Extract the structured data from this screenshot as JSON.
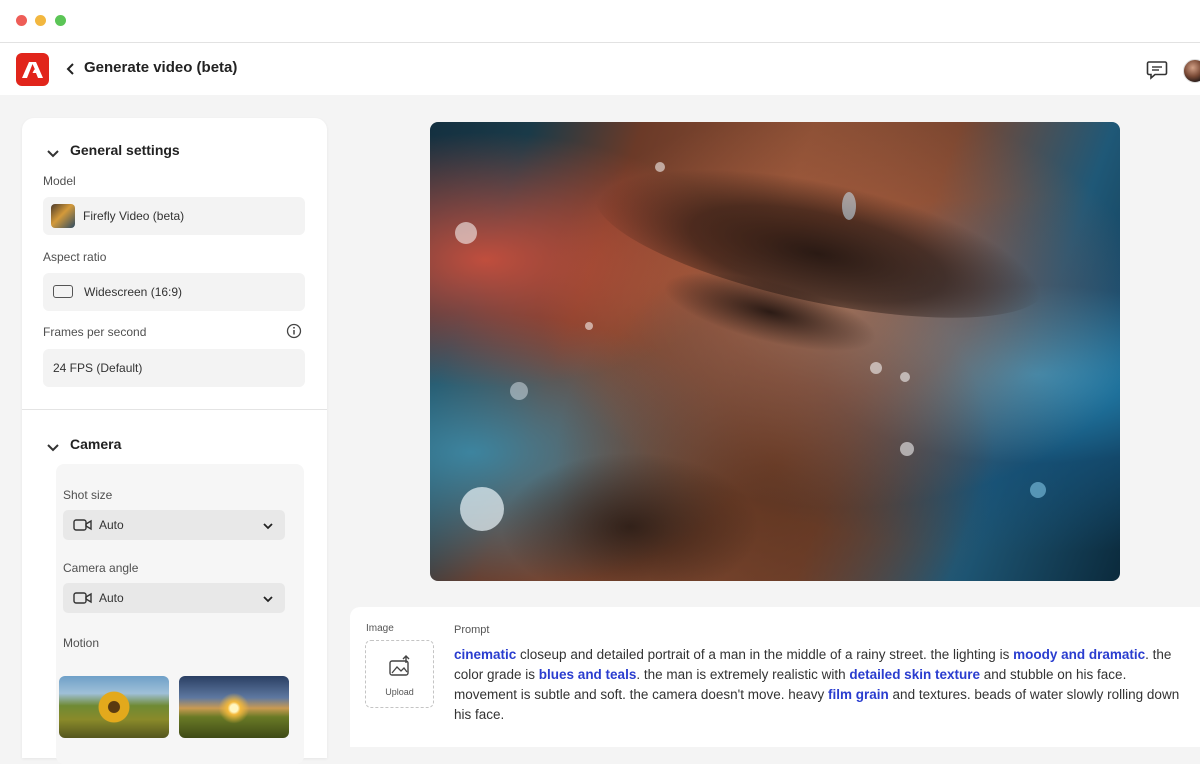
{
  "app": {
    "page_title": "Generate video (beta)"
  },
  "general_settings": {
    "heading": "General settings",
    "model_label": "Model",
    "model_value": "Firefly Video (beta)",
    "aspect_label": "Aspect ratio",
    "aspect_value": "Widescreen (16:9)",
    "fps_label": "Frames per second",
    "fps_value": "24 FPS (Default)"
  },
  "camera": {
    "heading": "Camera",
    "shot_size_label": "Shot size",
    "shot_size_value": "Auto",
    "angle_label": "Camera angle",
    "angle_value": "Auto",
    "motion_label": "Motion"
  },
  "prompt_panel": {
    "image_label": "Image",
    "upload_label": "Upload",
    "prompt_label": "Prompt",
    "prompt_segments": [
      {
        "text": "cinematic",
        "kw": true
      },
      {
        "text": " closeup and detailed portrait of a man in the middle of a rainy street. the lighting is ",
        "kw": false
      },
      {
        "text": "moody and dramatic",
        "kw": true
      },
      {
        "text": ". the color grade is ",
        "kw": false
      },
      {
        "text": "blues and teals",
        "kw": true
      },
      {
        "text": ". the man is extremely realistic with ",
        "kw": false
      },
      {
        "text": "detailed skin texture",
        "kw": true
      },
      {
        "text": " and stubble on his face. movement is subtle and soft. the camera doesn't move. heavy ",
        "kw": false
      },
      {
        "text": "film grain",
        "kw": true
      },
      {
        "text": " and textures. beads of water slowly rolling down his face.",
        "kw": false
      }
    ]
  },
  "icons": {
    "logo": "adobe-logo-icon",
    "back": "chevron-left-icon",
    "feedback": "chat-icon",
    "info": "info-icon",
    "dropdown": "chevron-down-icon",
    "camera": "video-camera-icon",
    "upload": "upload-image-icon"
  },
  "colors": {
    "accent_red": "#e1251b",
    "keyword_blue": "#2a3dcf"
  }
}
